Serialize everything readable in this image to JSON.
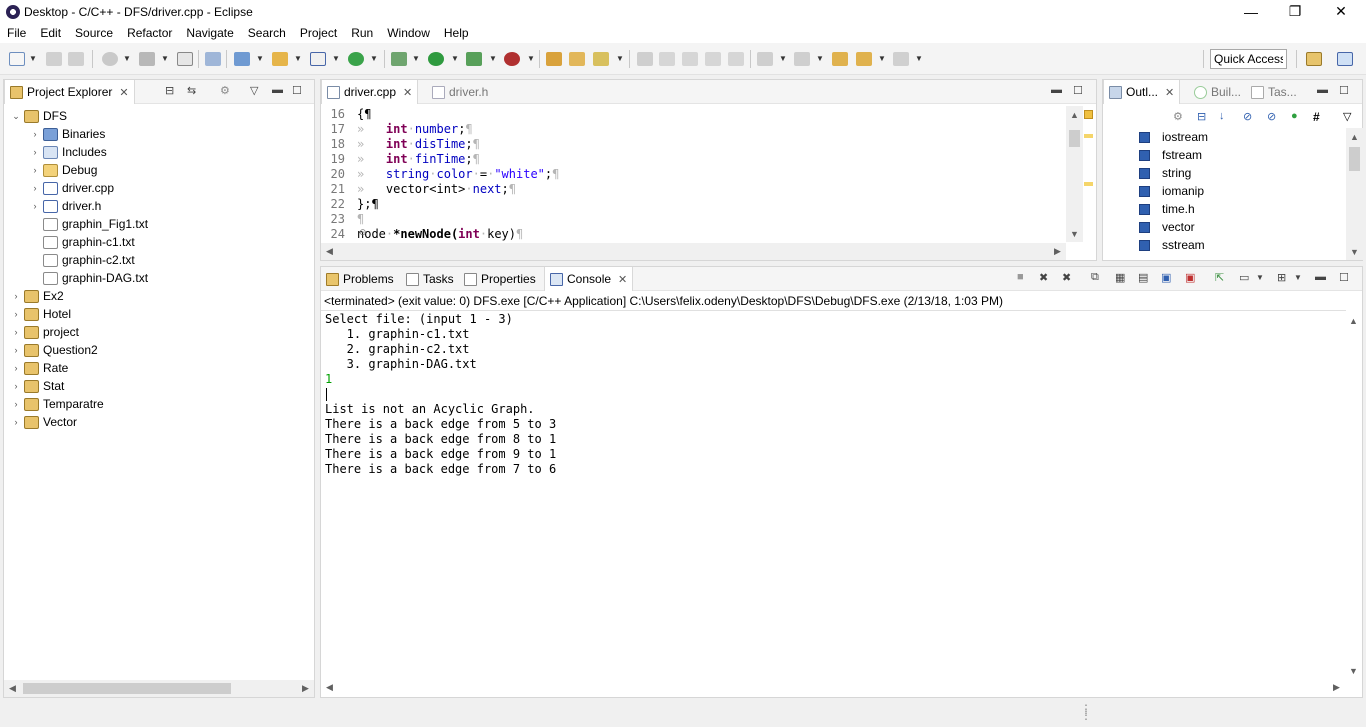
{
  "window": {
    "title": "Desktop - C/C++ - DFS/driver.cpp - Eclipse",
    "minimize": "—",
    "restore": "❐",
    "close": "✕"
  },
  "menu": [
    "File",
    "Edit",
    "Source",
    "Refactor",
    "Navigate",
    "Search",
    "Project",
    "Run",
    "Window",
    "Help"
  ],
  "toolbar": {
    "quick_access": "Quick Access"
  },
  "project_explorer": {
    "tab_label": "Project Explorer",
    "items": [
      {
        "label": "DFS",
        "expanded": true
      },
      {
        "label": "Binaries"
      },
      {
        "label": "Includes"
      },
      {
        "label": "Debug"
      },
      {
        "label": "driver.cpp"
      },
      {
        "label": "driver.h"
      },
      {
        "label": "graphin_Fig1.txt"
      },
      {
        "label": "graphin-c1.txt"
      },
      {
        "label": "graphin-c2.txt"
      },
      {
        "label": "graphin-DAG.txt"
      },
      {
        "label": "Ex2"
      },
      {
        "label": "Hotel"
      },
      {
        "label": "project"
      },
      {
        "label": "Question2"
      },
      {
        "label": "Rate"
      },
      {
        "label": "Stat"
      },
      {
        "label": "Temparatre"
      },
      {
        "label": "Vector"
      }
    ]
  },
  "editor": {
    "tabs": [
      {
        "label": "driver.cpp",
        "active": true
      },
      {
        "label": "driver.h",
        "active": false
      }
    ],
    "line_numbers": [
      "16",
      "17",
      "18",
      "19",
      "20",
      "21",
      "22",
      "23",
      "24"
    ],
    "lines": {
      "l16": "{¶",
      "l17_type": "int",
      "l17_name": "number",
      "l18_type": "int",
      "l18_name": "disTime",
      "l19_type": "int",
      "l19_name": "finTime",
      "l20_type": "string",
      "l20_name": "color",
      "l20_value": "\"white\"",
      "l21_text": "vector<int>",
      "l21_name": "next",
      "l22": "};¶",
      "l23": "¶",
      "l24_type": "node",
      "l24_func": "*newNode(",
      "l24_argtype": "int",
      "l24_arg": "key)"
    }
  },
  "outline": {
    "tabs": [
      {
        "label": "Outl...",
        "active": true
      },
      {
        "label": "Buil...",
        "active": false
      },
      {
        "label": "Tas...",
        "active": false
      }
    ],
    "items": [
      "iostream",
      "fstream",
      "string",
      "iomanip",
      "time.h",
      "vector",
      "sstream"
    ]
  },
  "bottom_panel": {
    "tabs": [
      {
        "label": "Problems",
        "active": false
      },
      {
        "label": "Tasks",
        "active": false
      },
      {
        "label": "Properties",
        "active": false
      },
      {
        "label": "Console",
        "active": true
      }
    ],
    "console_info": "<terminated> (exit value: 0) DFS.exe [C/C++ Application] C:\\Users\\felix.odeny\\Desktop\\DFS\\Debug\\DFS.exe (2/13/18, 1:03 PM)",
    "console_lines": [
      "Select file: (input 1 - 3)",
      "   1. graphin-c1.txt",
      "   2. graphin-c2.txt",
      "   3. graphin-DAG.txt",
      "1",
      "",
      "List is not an Acyclic Graph.",
      "There is a back edge from 5 to 3",
      "There is a back edge from 8 to 1",
      "There is a back edge from 9 to 1",
      "There is a back edge from 7 to 6"
    ]
  },
  "colors": {
    "keyword": "#7f0055",
    "string": "#2a00ff",
    "console_input": "#00a000"
  }
}
